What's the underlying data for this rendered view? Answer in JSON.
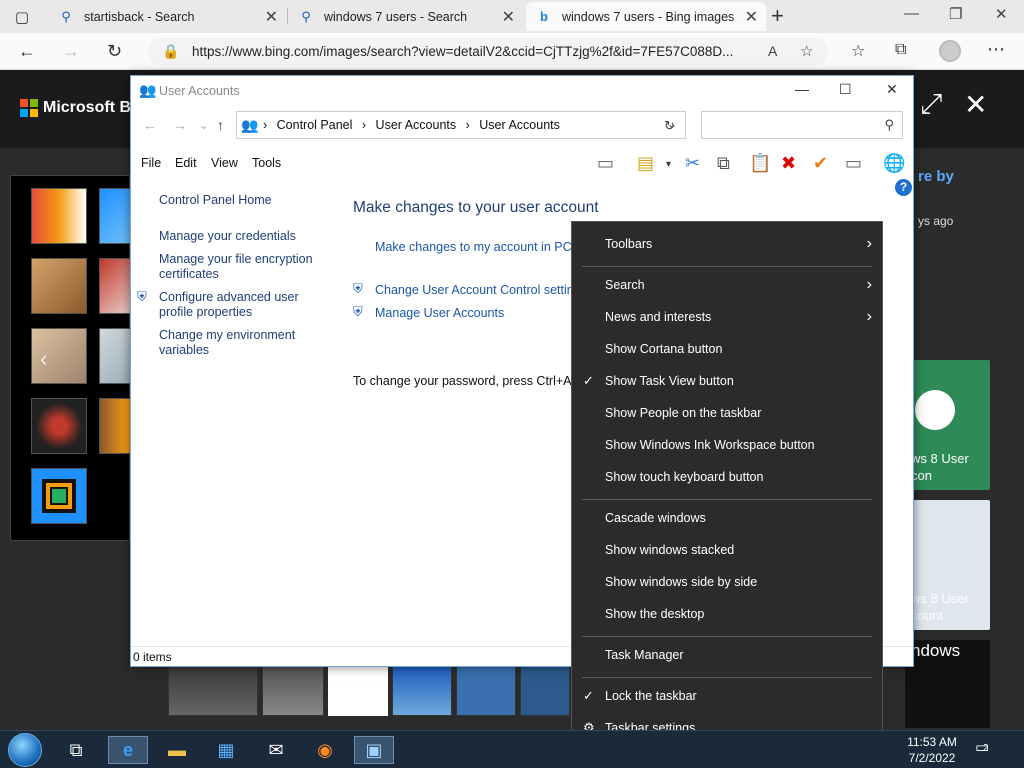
{
  "browser": {
    "tabs": [
      {
        "title": "startisback - Search",
        "icon": "search-icon"
      },
      {
        "title": "windows 7 users - Search",
        "icon": "search-icon"
      },
      {
        "title": "windows 7 users - Bing images",
        "icon": "bing-icon"
      }
    ],
    "url": "https://www.bing.com/images/search?view=detailV2&ccid=CjTTzjg%2f&id=7FE57C088D..."
  },
  "bing": {
    "logo_text": "Microsoft Bing",
    "side_text_1": "re by",
    "side_text_2": "ys ago",
    "card_1": "ws 8 User\ncon",
    "card_2": "ws 8 User\ncount",
    "card_3": "ndows"
  },
  "window": {
    "title": "User Accounts",
    "breadcrumbs": [
      "Control Panel",
      "User Accounts",
      "User Accounts"
    ],
    "search_placeholder": "",
    "menu": [
      "File",
      "Edit",
      "View",
      "Tools"
    ],
    "left_links": [
      "Control Panel Home",
      "Manage your credentials",
      "Manage your file encryption certificates",
      "Configure advanced user profile properties",
      "Change my environment variables"
    ],
    "heading": "Make changes to your user account",
    "pc_settings_link": "Make changes to my account in PC s",
    "uac_link": "Change User Account Control setting",
    "manage_link": "Manage User Accounts",
    "password_text": "To change your password, press Ctrl+Alt+",
    "status": "0 items"
  },
  "context_menu": {
    "groups": [
      [
        {
          "label": "Toolbars",
          "submenu": true
        }
      ],
      [
        {
          "label": "Search",
          "submenu": true
        },
        {
          "label": "News and interests",
          "submenu": true
        },
        {
          "label": "Show Cortana button"
        },
        {
          "label": "Show Task View button",
          "checked": true
        },
        {
          "label": "Show People on the taskbar"
        },
        {
          "label": "Show Windows Ink Workspace button"
        },
        {
          "label": "Show touch keyboard button"
        }
      ],
      [
        {
          "label": "Cascade windows"
        },
        {
          "label": "Show windows stacked"
        },
        {
          "label": "Show windows side by side"
        },
        {
          "label": "Show the desktop"
        }
      ],
      [
        {
          "label": "Task Manager"
        }
      ],
      [
        {
          "label": "Lock the taskbar",
          "checked": true
        },
        {
          "label": "Taskbar settings",
          "icon": "gear-icon"
        }
      ]
    ]
  },
  "taskbar": {
    "time": "11:53 AM",
    "date": "7/2/2022",
    "notifications": "2"
  }
}
